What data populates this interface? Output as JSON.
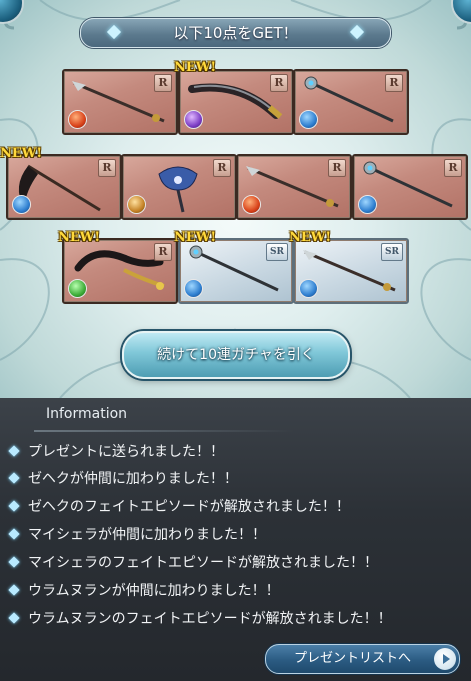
{
  "header": {
    "title": "以下10点をGET！"
  },
  "items": [
    {
      "rarity": "R",
      "element": "fire",
      "weapon": "spear",
      "is_new": false
    },
    {
      "rarity": "R",
      "element": "dark",
      "weapon": "sword",
      "is_new": true
    },
    {
      "rarity": "R",
      "element": "water",
      "weapon": "staff",
      "is_new": false
    },
    {
      "rarity": "R",
      "element": "water",
      "weapon": "scythe",
      "is_new": true
    },
    {
      "rarity": "R",
      "element": "earth",
      "weapon": "axe",
      "is_new": false
    },
    {
      "rarity": "R",
      "element": "fire",
      "weapon": "spear",
      "is_new": false
    },
    {
      "rarity": "R",
      "element": "water",
      "weapon": "staff",
      "is_new": false
    },
    {
      "rarity": "R",
      "element": "wind",
      "weapon": "harp",
      "is_new": true
    },
    {
      "rarity": "SR",
      "element": "water",
      "weapon": "staff",
      "is_new": true
    },
    {
      "rarity": "SR",
      "element": "water",
      "weapon": "spear",
      "is_new": true
    }
  ],
  "labels": {
    "new_badge": "NEW!"
  },
  "gacha_button": {
    "label": "続けて10連ガチャを引く"
  },
  "info": {
    "title": "Information",
    "messages": [
      "プレゼントに送られました！！",
      "ゼヘクが仲間に加わりました！！",
      "ゼヘクのフェイトエピソードが解放されました！！",
      "マイシェラが仲間に加わりました！！",
      "マイシェラのフェイトエピソードが解放されました！！",
      "ウラムヌランが仲間に加わりました！！",
      "ウラムヌランのフェイトエピソードが解放されました！！"
    ]
  },
  "present_button": {
    "label": "プレゼントリストへ"
  },
  "colors": {
    "r_card": "#c48a7e",
    "sr_card": "#c9d8e2",
    "new_badge": "#ffd93b",
    "bullet": "#b9eaff"
  }
}
